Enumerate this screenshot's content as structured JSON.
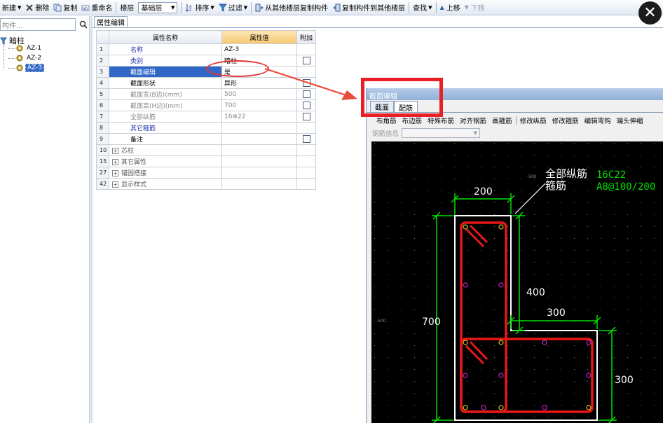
{
  "toolbar": {
    "new_label": "新建",
    "delete_label": "删除",
    "copy_label": "复制",
    "rename_label": "重命名",
    "floor_label": "楼层",
    "floor_value": "基础层",
    "sort_label": "排序",
    "filter_label": "过滤",
    "copy_from_other_floor_label": "从其他楼层复制构件",
    "copy_to_other_floor_label": "复制构件到其他楼层",
    "find_label": "查找",
    "move_up_label": "上移",
    "move_down_label": "下移"
  },
  "tree": {
    "search_placeholder": "构件...",
    "root_label": "暗柱",
    "items": [
      {
        "label": "AZ-1"
      },
      {
        "label": "AZ-2"
      },
      {
        "label": "AZ-3"
      }
    ],
    "selected_index": 2
  },
  "property_panel": {
    "tab_label": "属性编辑",
    "headers": {
      "name": "属性名称",
      "value": "属性值",
      "attach": "附加"
    },
    "rows": [
      {
        "num": "1",
        "name": "名称",
        "value": "AZ-3",
        "checkbox": false,
        "style": "blue"
      },
      {
        "num": "2",
        "name": "类别",
        "value": "暗柱",
        "checkbox": true,
        "style": "blue"
      },
      {
        "num": "3",
        "name": "截面编辑",
        "value": "是",
        "checkbox": false,
        "style": "blue",
        "selected": true
      },
      {
        "num": "4",
        "name": "截面形状",
        "value": "异形",
        "checkbox": true,
        "style": "normal"
      },
      {
        "num": "5",
        "name": "截面宽(B边)(mm)",
        "value": "500",
        "checkbox": true,
        "style": "gray"
      },
      {
        "num": "6",
        "name": "截面高(H边)(mm)",
        "value": "700",
        "checkbox": true,
        "style": "gray"
      },
      {
        "num": "7",
        "name": "全部纵筋",
        "value": "16⊕22",
        "checkbox": true,
        "style": "gray"
      },
      {
        "num": "8",
        "name": "其它箍筋",
        "value": "",
        "checkbox": false,
        "style": "blue"
      },
      {
        "num": "9",
        "name": "备注",
        "value": "",
        "checkbox": true,
        "style": "normal"
      },
      {
        "num": "10",
        "name": "芯柱",
        "value": "",
        "checkbox": false,
        "style": "group"
      },
      {
        "num": "15",
        "name": "其它属性",
        "value": "",
        "checkbox": false,
        "style": "group"
      },
      {
        "num": "27",
        "name": "锚固搭接",
        "value": "",
        "checkbox": false,
        "style": "group"
      },
      {
        "num": "42",
        "name": "显示样式",
        "value": "",
        "checkbox": false,
        "style": "group"
      }
    ]
  },
  "section_editor": {
    "title": "截面编辑",
    "tabs": [
      "截面",
      "配筋"
    ],
    "active_tab": 1,
    "toolbar": [
      "布角筋",
      "布边筋",
      "特殊布筋",
      "对齐钢筋",
      "画箍筋",
      "修改纵筋",
      "修改箍筋",
      "编辑弯钩",
      "端头伸缩"
    ],
    "rebar_info_label": "钢筋信息",
    "drawing": {
      "label_all_long_bars": "全部纵筋",
      "value_all_long_bars": "16C22",
      "label_stirrup": "箍筋",
      "value_stirrup": "A8@100/200",
      "dim_top_width": "200",
      "dim_height_total": "700",
      "dim_step_height": "400",
      "dim_step_width": "300",
      "dim_bottom_height": "300",
      "axis_small_top": "-500",
      "axis_small_left": "-500"
    },
    "colors": {
      "dimension": "#00e000",
      "outline": "#ffffff",
      "stirrup": "#e81818",
      "annotation": "#ea1e25"
    }
  }
}
